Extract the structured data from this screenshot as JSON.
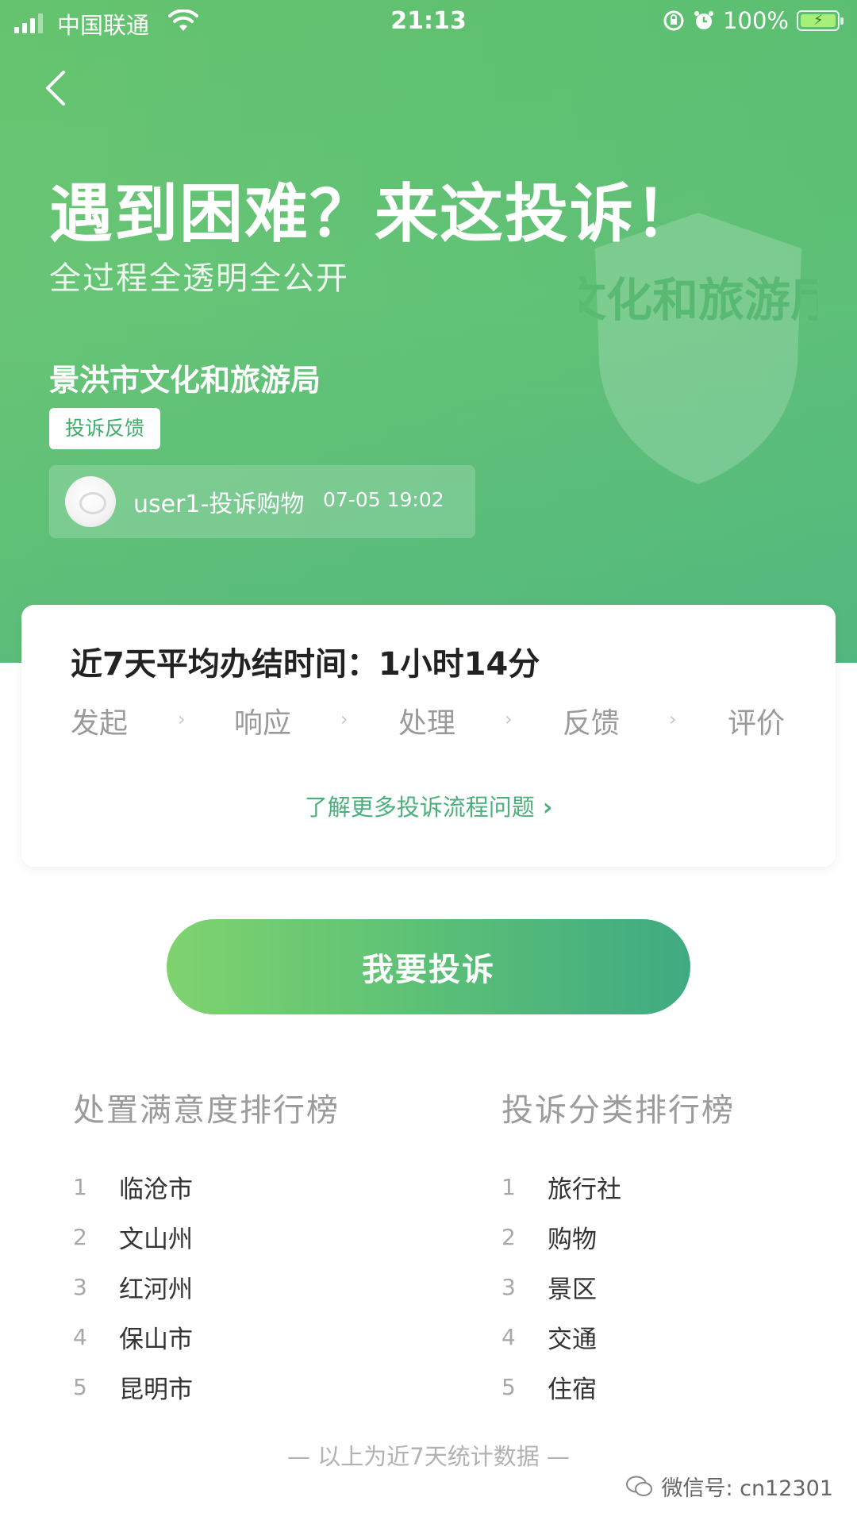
{
  "status": {
    "carrier": "中国联通",
    "time": "21:13",
    "battery": "100%"
  },
  "hero": {
    "title": "遇到困难？来这投诉！",
    "subtitle": "全过程全透明全公开",
    "org": "景洪市文化和旅游局",
    "tag": "投诉反馈",
    "feed_text": "user1-投诉购物",
    "feed_time": "07-05 19:02",
    "watermark_text": "文化和旅游厅"
  },
  "card": {
    "avg_label": "近7天平均办结时间：",
    "avg_value": "1小时14分",
    "steps": [
      "发起",
      "响应",
      "处理",
      "反馈",
      "评价"
    ],
    "learn_more": "了解更多投诉流程问题"
  },
  "action": {
    "complain_label": "我要投诉"
  },
  "rankings": {
    "satisfaction": {
      "title": "处置满意度排行榜",
      "items": [
        {
          "rank": "1",
          "name": "临沧市"
        },
        {
          "rank": "2",
          "name": "文山州"
        },
        {
          "rank": "3",
          "name": "红河州"
        },
        {
          "rank": "4",
          "name": "保山市"
        },
        {
          "rank": "5",
          "name": "昆明市"
        }
      ]
    },
    "category": {
      "title": "投诉分类排行榜",
      "items": [
        {
          "rank": "1",
          "name": "旅行社"
        },
        {
          "rank": "2",
          "name": "购物"
        },
        {
          "rank": "3",
          "name": "景区"
        },
        {
          "rank": "4",
          "name": "交通"
        },
        {
          "rank": "5",
          "name": "住宿"
        }
      ]
    }
  },
  "footnote": "— 以上为近7天统计数据 —",
  "wechat_mark": "微信号: cn12301",
  "colors": {
    "brand_green": "#5fc06f",
    "accent_teal": "#40aa82",
    "link_green": "#4cb07c"
  }
}
